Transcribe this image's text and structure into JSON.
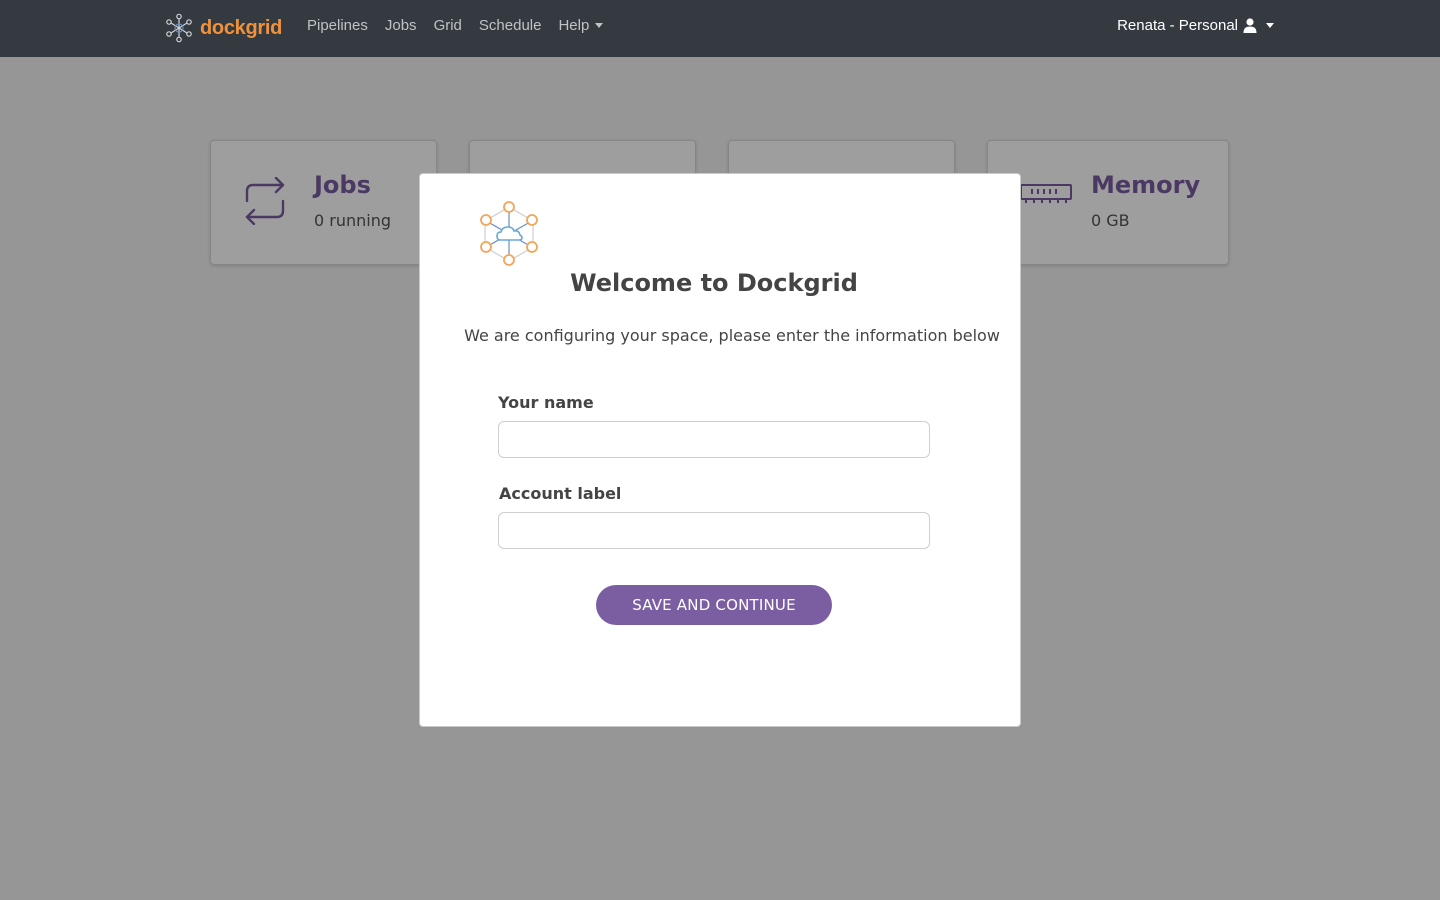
{
  "navbar": {
    "brand": "dockgrid",
    "links": [
      {
        "label": "Pipelines"
      },
      {
        "label": "Jobs"
      },
      {
        "label": "Grid"
      },
      {
        "label": "Schedule"
      },
      {
        "label": "Help",
        "dropdown": true
      }
    ],
    "user": "Renata - Personal"
  },
  "cards": [
    {
      "title": "Jobs",
      "value": "0 running",
      "icon": "repeat-arrows-icon"
    },
    {
      "title": "",
      "value": ""
    },
    {
      "title": "",
      "value": ""
    },
    {
      "title": "Memory",
      "value": "0 GB",
      "icon": "memory-chip-icon"
    }
  ],
  "modal": {
    "title": "Welcome to Dockgrid",
    "subtitle": "We are configuring your space, please enter the information below",
    "name_label": "Your name",
    "name_value": "",
    "account_label": "Account label",
    "account_value": "",
    "save_label": "SAVE AND CONTINUE"
  },
  "colors": {
    "navbar": "#343a40",
    "brand": "#f0923b",
    "accent": "#7b5ea2",
    "overlay": "rgba(0,0,0,0.38)"
  }
}
